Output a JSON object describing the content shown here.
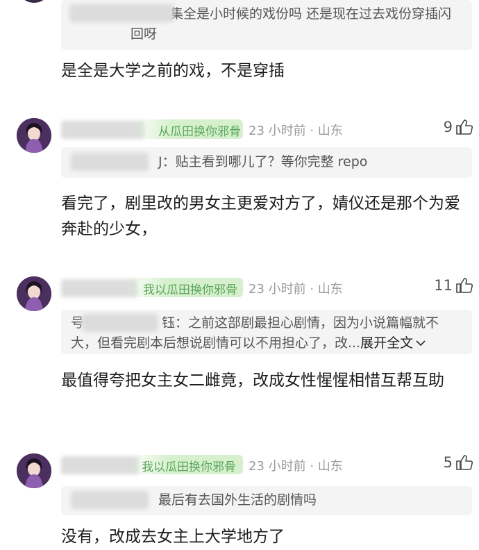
{
  "comments": [
    {
      "quote": "前面十集全是小时候的戏份吗 还是现在过去戏份穿插闪回呀",
      "reply": "是全是大学之前的戏，不是穿插"
    },
    {
      "name_fragment": "从瓜田换你邪骨",
      "time": "23 小时前 · 山东",
      "likes": "9",
      "quote_suffix": "J：贴主看到哪儿了？等你完整 repo",
      "reply": "看完了，剧里改的男女主更爱对方了，婧仪还是那个为爱奔赴的少女，"
    },
    {
      "name_fragment": "我以瓜田换你邪骨",
      "time": "23 小时前 · 山东",
      "likes": "11",
      "quote_prefix": "号",
      "quote_line1": "钰：之前这部剧最担心剧情，因为小说篇幅就不",
      "quote_line2": "大，但看完剧本后想说剧情可以不用担心了，改...",
      "expand_label": "展开全文",
      "reply": "最值得夸把女主女二雌竟，改成女性惺惺相惜互帮互助"
    },
    {
      "name_fragment": "我以瓜田换你邪骨",
      "time": "23 小时前 · 山东",
      "likes": "5",
      "quote_suffix": "最后有去国外生活的剧情吗",
      "reply": "没有，改成去女主上大学地方了"
    }
  ],
  "icons": {
    "like": "thumbs-up-icon",
    "expand": "chevron-down-icon",
    "avatar": "user-avatar"
  },
  "colors": {
    "name_green": "#5aa55a",
    "meta_gray": "#9a9a9a",
    "quote_bg": "#f4f4f4"
  }
}
